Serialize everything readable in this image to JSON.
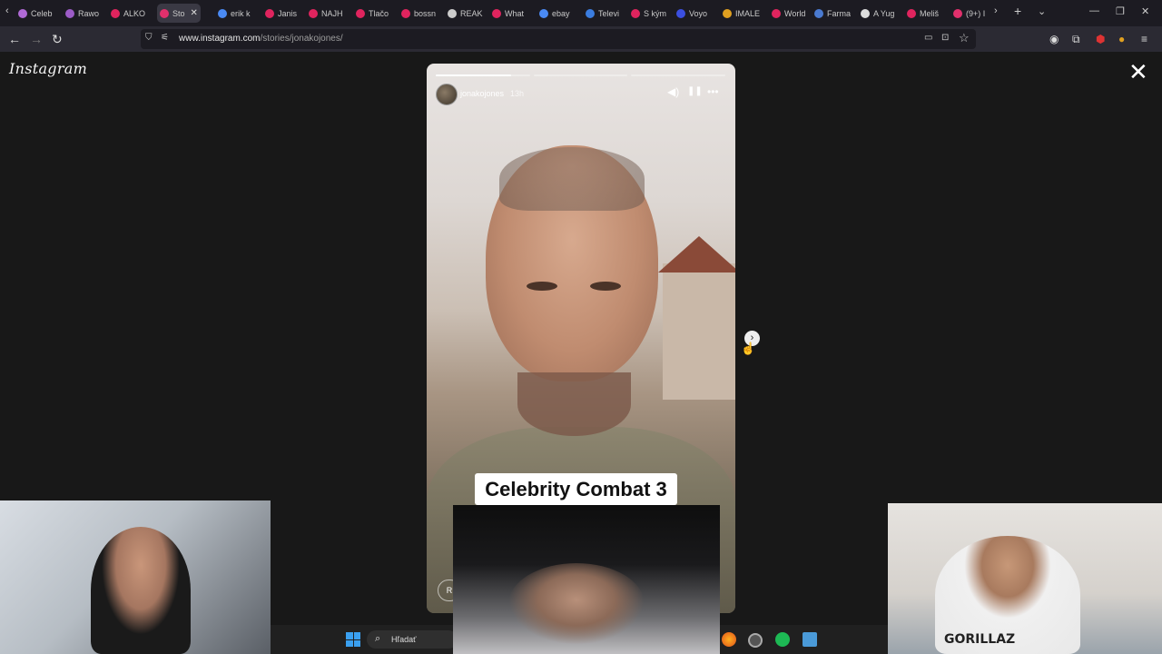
{
  "browser": {
    "tabs": [
      {
        "label": "Celeb",
        "color": "#b06ad6"
      },
      {
        "label": "Rawo",
        "color": "#9c5cc7"
      },
      {
        "label": "ALKO",
        "color": "#e0245e"
      },
      {
        "label": "Sto",
        "color": "#e1306c",
        "active": true
      },
      {
        "label": "erik k",
        "color": "#4a8af4"
      },
      {
        "label": "Janis",
        "color": "#e0245e"
      },
      {
        "label": "NAJH",
        "color": "#e0245e"
      },
      {
        "label": "Tlačo",
        "color": "#e0245e"
      },
      {
        "label": "bossn",
        "color": "#e0245e"
      },
      {
        "label": "REAK",
        "color": "#cccccc"
      },
      {
        "label": "What",
        "color": "#e0245e"
      },
      {
        "label": "ebay",
        "color": "#4a8af4"
      },
      {
        "label": "Televi",
        "color": "#3b7de0"
      },
      {
        "label": "S kým",
        "color": "#e0245e"
      },
      {
        "label": "Voyo",
        "color": "#3b4fe0"
      },
      {
        "label": "IMALE",
        "color": "#e0a020"
      },
      {
        "label": "World",
        "color": "#e0245e"
      },
      {
        "label": "Farma",
        "color": "#4a7ad0"
      },
      {
        "label": "A Yug",
        "color": "#dddddd"
      },
      {
        "label": "Meliš",
        "color": "#e0245e"
      },
      {
        "label": "(9+) I",
        "color": "#e1306c"
      }
    ],
    "url_domain": "www.instagram.com",
    "url_path": "/stories/jonakojones/",
    "new_tab": "+",
    "tab_close": "✕"
  },
  "instagram": {
    "logo": "Instagram",
    "close": "✕"
  },
  "story": {
    "username": "jonakojones",
    "time": "13h",
    "caption": "Celebrity Combat 3",
    "reply_label": "R",
    "progress": [
      1.0,
      0.0,
      0.0
    ],
    "progress_partial": 0.8
  },
  "taskbar": {
    "search_label": "Hľadať"
  },
  "webcam": {
    "shirt_text": "GORILLAZ"
  },
  "icons": {
    "mute": "🔇",
    "pause": "❚❚",
    "more": "•••",
    "next": "›",
    "back": "←",
    "forward": "→",
    "reload": "↻",
    "star": "☆",
    "search": "⌕"
  }
}
